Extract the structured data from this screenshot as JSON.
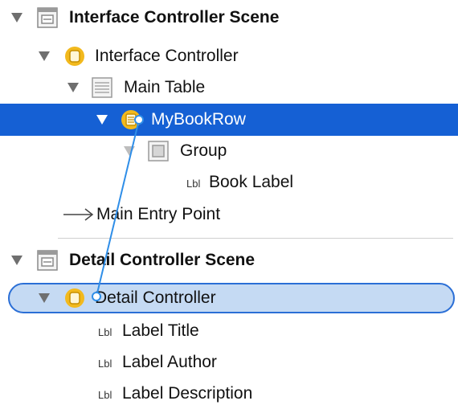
{
  "tree": {
    "interface_scene": {
      "label": "Interface Controller Scene",
      "icon": "storyboard-scene-icon"
    },
    "interface_controller": {
      "label": "Interface Controller",
      "icon": "controller-icon"
    },
    "main_table": {
      "label": "Main Table",
      "icon": "table-icon"
    },
    "my_book_row": {
      "label": "MyBookRow",
      "icon": "row-controller-icon"
    },
    "group": {
      "label": "Group",
      "icon": "group-icon"
    },
    "book_label": {
      "tag": "Lbl",
      "label": "Book Label"
    },
    "main_entry_point": {
      "label": "Main Entry Point",
      "icon": "arrow-icon"
    },
    "detail_scene": {
      "label": "Detail Controller Scene",
      "icon": "storyboard-scene-icon"
    },
    "detail_controller": {
      "label": "Detail Controller",
      "icon": "controller-icon"
    },
    "label_title": {
      "tag": "Lbl",
      "label": "Label Title"
    },
    "label_author": {
      "tag": "Lbl",
      "label": "Label Author"
    },
    "label_description": {
      "tag": "Lbl",
      "label": "Label Description"
    }
  },
  "colors": {
    "selection": "#1560d4",
    "drop_target_fill": "#c5daf3",
    "drop_target_border": "#2b6fd6",
    "controller_icon": "#f2b91d",
    "connection_line": "#2f8ee8"
  }
}
